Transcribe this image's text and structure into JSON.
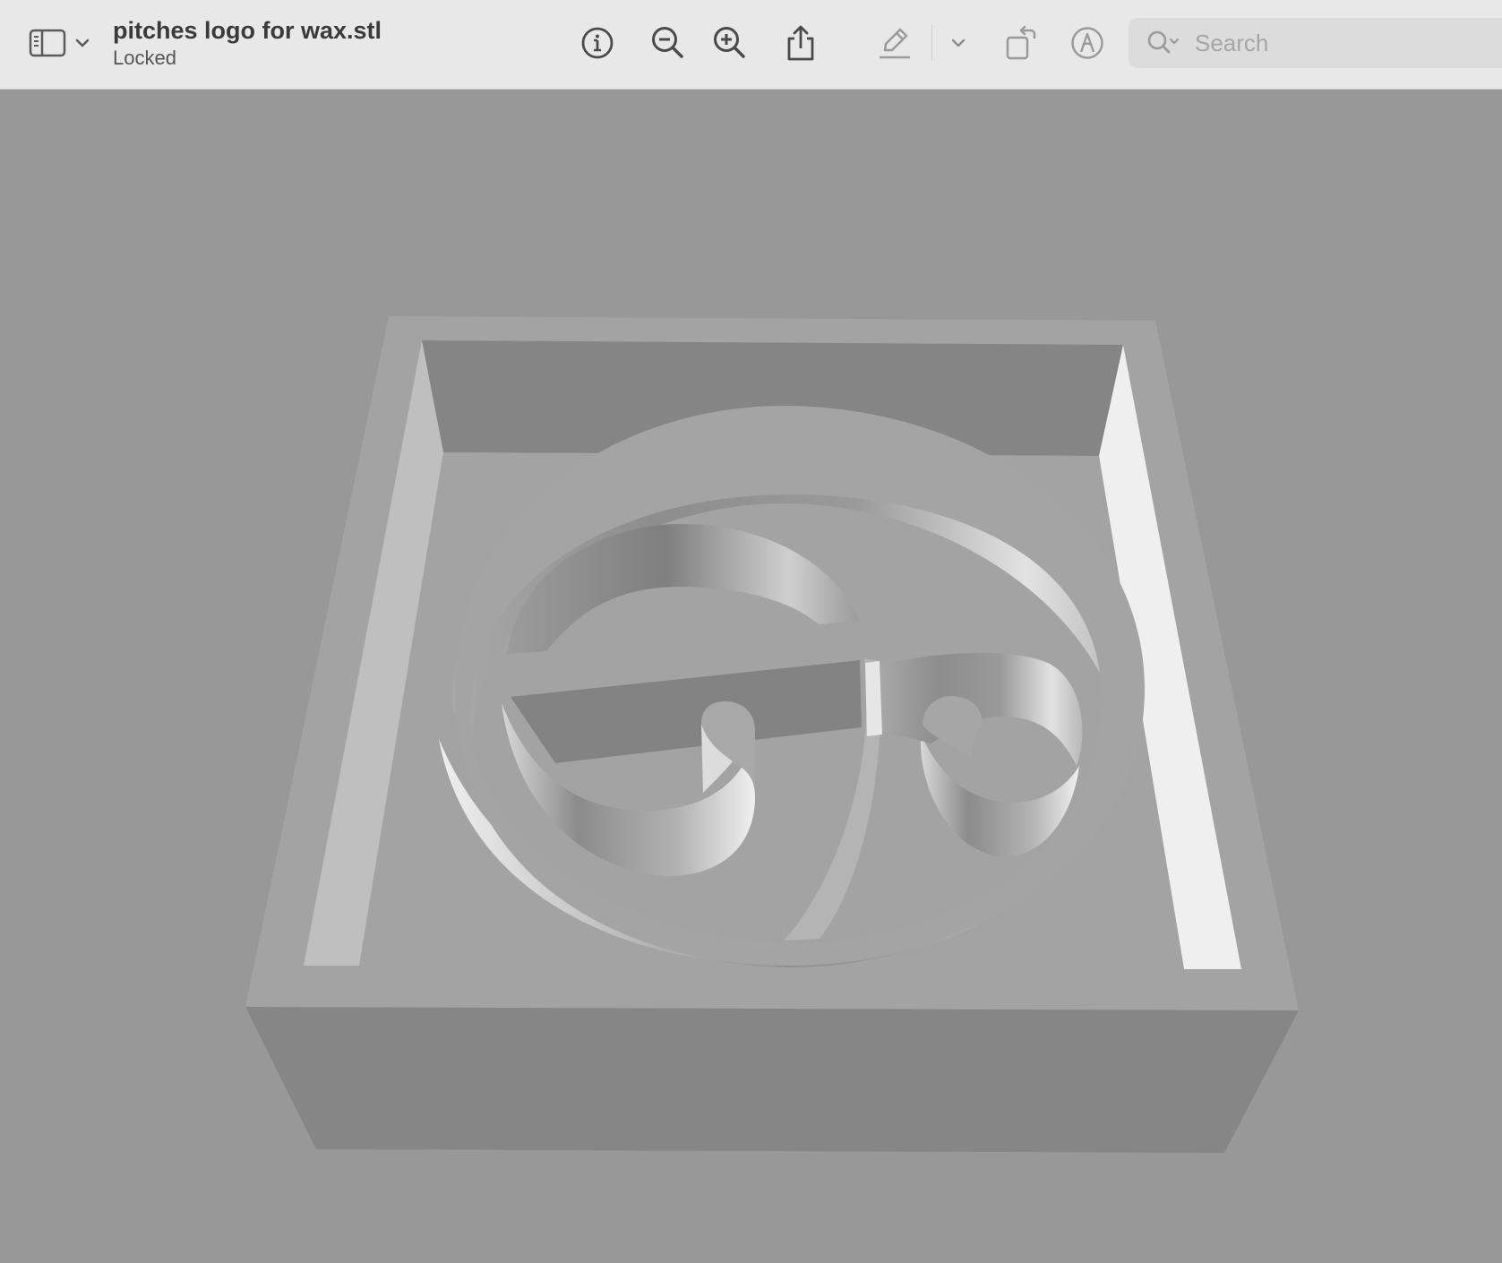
{
  "document": {
    "title": "pitches logo for wax.stl",
    "subtitle": "Locked"
  },
  "toolbar": {
    "sidebar_toggle_icon": "sidebar-icon",
    "sidebar_menu_icon": "chevron-down-icon",
    "buttons": [
      {
        "name": "info",
        "icon": "info-circle-icon"
      },
      {
        "name": "zoom-out",
        "icon": "zoom-out-icon"
      },
      {
        "name": "zoom-in",
        "icon": "zoom-in-icon"
      },
      {
        "name": "share",
        "icon": "share-icon"
      },
      {
        "name": "highlight",
        "icon": "highlighter-pen-icon"
      },
      {
        "name": "highlight-menu",
        "icon": "chevron-down-icon"
      },
      {
        "name": "rotate",
        "icon": "rotate-left-icon"
      },
      {
        "name": "markup",
        "icon": "markup-pen-circle-icon"
      }
    ]
  },
  "search": {
    "placeholder": "Search",
    "value": "",
    "icon": "search-icon"
  },
  "viewer": {
    "content": "3D model render",
    "background_color": "#989898",
    "model_color": "#a3a3a3"
  }
}
